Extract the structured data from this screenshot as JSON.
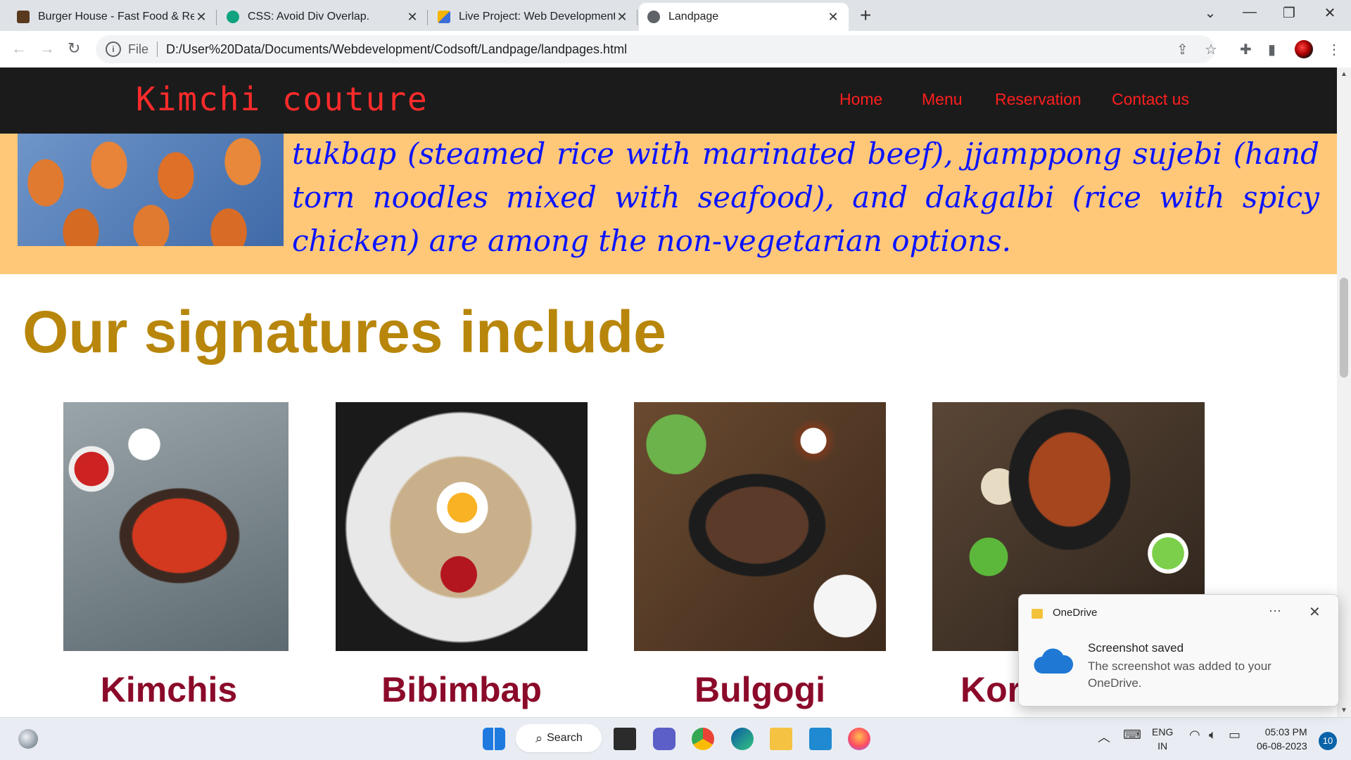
{
  "browser": {
    "tabs": [
      {
        "title": "Burger House - Fast Food & Rest",
        "favicon_color": "#5a3a1e",
        "close": "✕"
      },
      {
        "title": "CSS: Avoid Div Overlap.",
        "favicon_color": "#10a37f",
        "close": "✕"
      },
      {
        "title": "Live Project: Web Development -",
        "favicon_color": "#3b6ed8",
        "close": "✕"
      },
      {
        "title": "Landpage",
        "favicon_color": "#5f6368",
        "close": "✕"
      }
    ],
    "new_tab": "+",
    "address_prefix": "File",
    "url": "D:/User%20Data/Documents/Webdevelopment/Codsoft/Landpage/landpages.html"
  },
  "site": {
    "brand": "Kimchi couture",
    "nav": [
      "Home",
      "Menu",
      "Reservation",
      "Contact us"
    ],
    "about_text": "tukbap (steamed rice with marinated beef), jjamppong sujebi (hand torn noodles mixed with seafood), and dakgalbi (rice with spicy chicken) are among the non-vegetarian options.",
    "signatures_title": "Our signatures include",
    "dishes": [
      {
        "name": "Kimchis"
      },
      {
        "name": "Bibimbap"
      },
      {
        "name": "Bulgogi"
      },
      {
        "name": "Kor"
      }
    ]
  },
  "toast": {
    "app": "OneDrive",
    "more": "···",
    "close": "✕",
    "heading": "Screenshot saved",
    "body": "The screenshot was added to your OneDrive."
  },
  "taskbar": {
    "search_label": "Search",
    "lang_line1": "ENG",
    "lang_line2": "IN",
    "time": "05:03 PM",
    "date": "06-08-2023",
    "notification_count": "10"
  }
}
